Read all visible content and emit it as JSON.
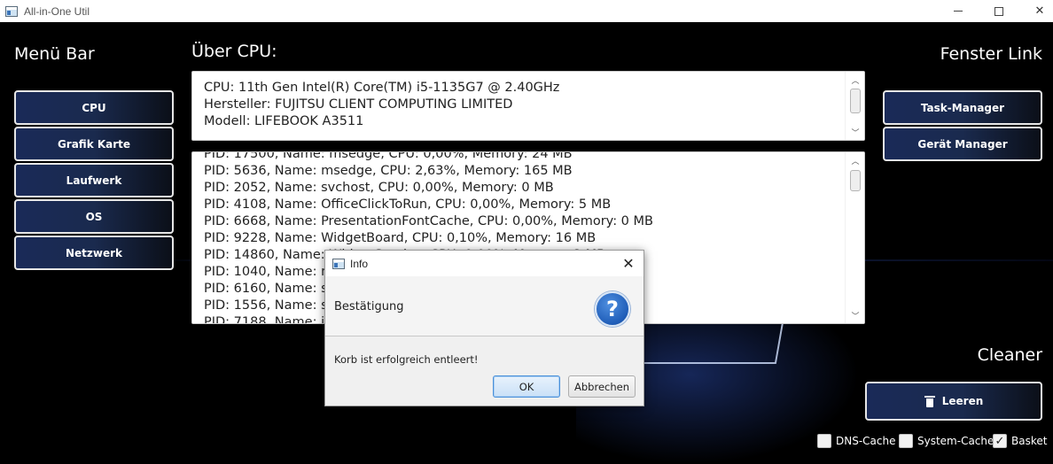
{
  "window": {
    "title": "All-in-One Util",
    "min_glyph": "minimize-icon",
    "max_glyph": "maximize-icon",
    "close_glyph": "✕"
  },
  "menu": {
    "heading": "Menü Bar",
    "items": [
      {
        "label": "CPU"
      },
      {
        "label": "Grafik Karte"
      },
      {
        "label": "Laufwerk"
      },
      {
        "label": "OS"
      },
      {
        "label": "Netzwerk"
      }
    ]
  },
  "cpu_section": {
    "heading": "Über CPU:",
    "info_lines": [
      "CPU: 11th Gen Intel(R) Core(TM) i5-1135G7 @ 2.40GHz",
      "Hersteller: FUJITSU CLIENT COMPUTING LIMITED",
      "Modell: LIFEBOOK A3511"
    ],
    "process_lines": [
      "PID: 17500, Name: msedge, CPU: 0,00%, Memory: 24 MB",
      "PID: 5636, Name: msedge, CPU: 2,63%, Memory: 165 MB",
      "PID: 2052, Name: svchost, CPU: 0,00%, Memory: 0 MB",
      "PID: 4108, Name: OfficeClickToRun, CPU: 0,00%, Memory: 5 MB",
      "PID: 6668, Name: PresentationFontCache, CPU: 0,00%, Memory: 0 MB",
      "PID: 9228, Name: WidgetBoard, CPU: 0,10%, Memory: 16 MB",
      "PID: 14860, Name: WidgetService, CPU: 0,00%, Memory: 2 MB",
      "PID: 1040, Name: m",
      "PID: 6160, Name: sv",
      "PID: 1556, Name: sv",
      "PID: 7188, Name: io"
    ]
  },
  "fenster": {
    "heading": "Fenster Link",
    "items": [
      {
        "label": "Task-Manager"
      },
      {
        "label": "Gerät Manager"
      }
    ]
  },
  "cleaner": {
    "heading": "Cleaner",
    "button_label": "Leeren",
    "button_icon": "trash-icon",
    "options": [
      {
        "label": "DNS-Cache",
        "checked": false
      },
      {
        "label": "System-Cache",
        "checked": false
      },
      {
        "label": "Basket",
        "checked": true
      }
    ]
  },
  "dialog": {
    "title": "Info",
    "header": "Bestätigung",
    "icon": "question-icon",
    "icon_glyph": "?",
    "message": "Korb ist erfolgreich entleert!",
    "ok_label": "OK",
    "cancel_label": "Abbrechen"
  }
}
